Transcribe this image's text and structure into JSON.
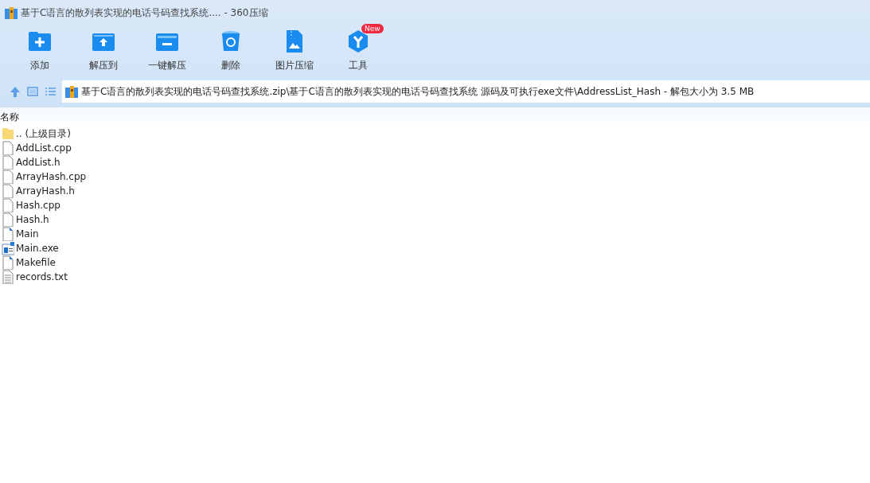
{
  "window": {
    "title": "基于C语言的散列表实现的电话号码查找系统.... - 360压缩"
  },
  "toolbar": [
    {
      "label": "添加",
      "kind": "add"
    },
    {
      "label": "解压到",
      "kind": "extract"
    },
    {
      "label": "一键解压",
      "kind": "oneclick"
    },
    {
      "label": "删除",
      "kind": "delete"
    },
    {
      "label": "图片压缩",
      "kind": "image"
    },
    {
      "label": "工具",
      "kind": "tools",
      "badge": "New"
    }
  ],
  "address_bar": {
    "path": "基于C语言的散列表实现的电话号码查找系统.zip\\基于C语言的散列表实现的电话号码查找系统 源码及可执行exe文件\\AddressList_Hash - 解包大小为 3.5 MB"
  },
  "file_list": {
    "columns": [
      "名称"
    ],
    "rows": [
      {
        "name": ".. (上级目录)",
        "kind": "folder"
      },
      {
        "name": "AddList.cpp",
        "kind": "file"
      },
      {
        "name": "AddList.h",
        "kind": "file"
      },
      {
        "name": "ArrayHash.cpp",
        "kind": "file"
      },
      {
        "name": "ArrayHash.h",
        "kind": "file"
      },
      {
        "name": "Hash.cpp",
        "kind": "file"
      },
      {
        "name": "Hash.h",
        "kind": "file"
      },
      {
        "name": "Main",
        "kind": "script"
      },
      {
        "name": "Main.exe",
        "kind": "exe"
      },
      {
        "name": "Makefile",
        "kind": "script"
      },
      {
        "name": "records.txt",
        "kind": "text"
      }
    ]
  }
}
